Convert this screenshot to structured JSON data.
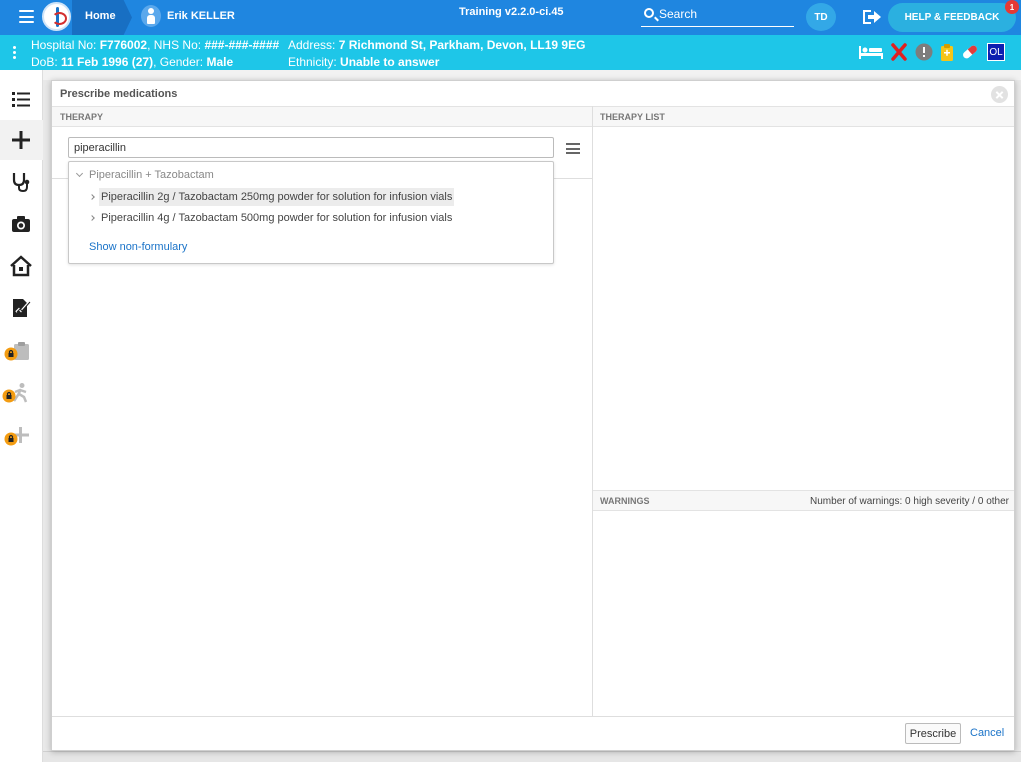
{
  "topbar": {
    "home_label": "Home",
    "patient_name": "Erik KELLER",
    "training_label": "Training v2.2.0-ci.45",
    "search_label": "Search",
    "avatar_initials": "TD",
    "help_label": "HELP & FEEDBACK",
    "help_badge_count": "1",
    "colors": {
      "bar": "#1f86e0",
      "banner": "#1ec6e8",
      "help": "#2bb0e0"
    }
  },
  "banner": {
    "hospital_prefix": "Hospital No: ",
    "hospital_no": "F776002",
    "nhs_prefix": ", NHS No: ",
    "nhs_no": "###-###-####",
    "address_prefix": "Address: ",
    "address": "7 Richmond St, Parkham, Devon, LL19 9EG",
    "dob_prefix": "DoB: ",
    "dob": "11 Feb 1996 (27)",
    "gender_prefix": ", Gender: ",
    "gender": "Male",
    "ethnicity_prefix": "Ethnicity: ",
    "ethnicity": "Unable to answer",
    "icons": [
      "bed-icon",
      "allergy-x-icon",
      "alert-icon",
      "clipboard-icon",
      "pill-icon",
      "ol-badge-icon"
    ],
    "ol_badge": "OL"
  },
  "sidebar": {
    "items": [
      {
        "icon": "list-icon",
        "locked": false
      },
      {
        "icon": "plus-icon",
        "locked": false
      },
      {
        "icon": "stethoscope-icon",
        "locked": false
      },
      {
        "icon": "camera-icon",
        "locked": false
      },
      {
        "icon": "home-icon",
        "locked": false
      },
      {
        "icon": "document-edit-icon",
        "locked": false
      },
      {
        "icon": "clipboard-icon",
        "locked": true
      },
      {
        "icon": "walking-icon",
        "locked": true
      },
      {
        "icon": "add-icon",
        "locked": true
      }
    ]
  },
  "dialog": {
    "title": "Prescribe medications",
    "therapy_header": "THERAPY",
    "therapy_list_header": "THERAPY LIST",
    "warnings_header": "WARNINGS",
    "warnings_count": "Number of warnings: 0 high severity / 0 other",
    "search_value": "piperacillin",
    "dropdown": {
      "group": "Piperacillin + Tazobactam",
      "items": [
        "Piperacillin 2g / Tazobactam 250mg powder for solution for infusion vials",
        "Piperacillin 4g / Tazobactam 500mg powder for solution for infusion vials"
      ],
      "non_formulary_link": "Show non-formulary"
    },
    "prescribe_label": "Prescribe",
    "cancel_label": "Cancel"
  }
}
